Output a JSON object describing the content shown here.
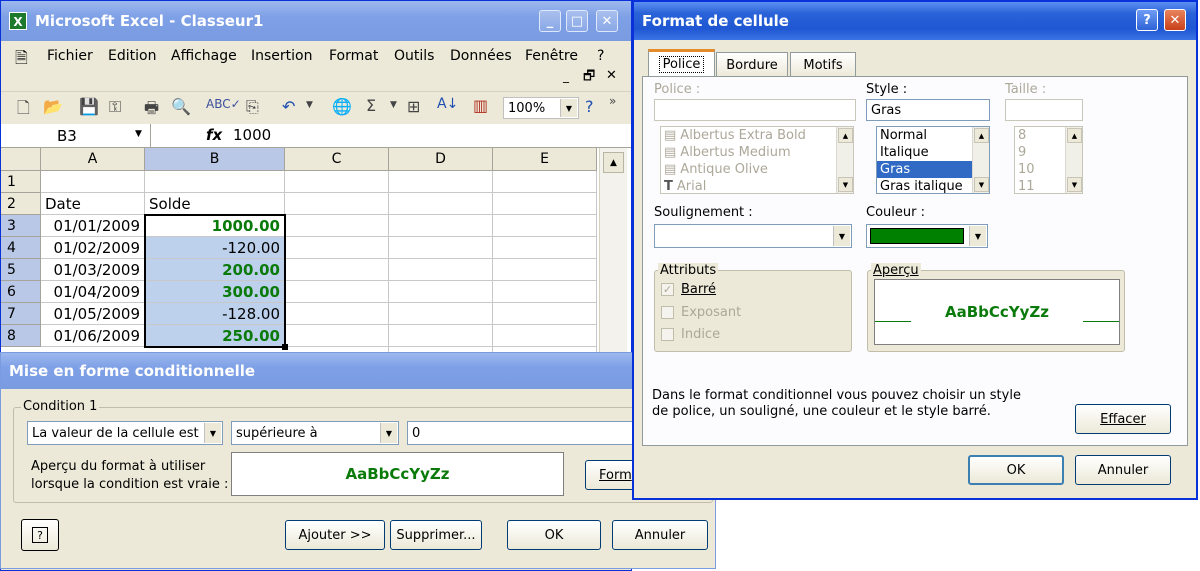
{
  "excel": {
    "title": "Microsoft Excel - Classeur1",
    "menu": [
      "Fichier",
      "Edition",
      "Affichage",
      "Insertion",
      "Format",
      "Outils",
      "Données",
      "Fenêtre",
      "?"
    ],
    "zoom": "100%",
    "name_box": "B3",
    "fx": "fx",
    "formula": "1000",
    "columns": [
      "A",
      "B",
      "C",
      "D",
      "E"
    ],
    "rows": [
      "1",
      "2",
      "3",
      "4",
      "5",
      "6",
      "7",
      "8"
    ],
    "cells": {
      "a2": "Date",
      "b2": "Solde",
      "a3": "01/01/2009",
      "b3": "1000.00",
      "a4": "01/02/2009",
      "b4": "-120.00",
      "a5": "01/03/2009",
      "b5": "200.00",
      "a6": "01/04/2009",
      "b6": "300.00",
      "a7": "01/05/2009",
      "b7": "-128.00",
      "a8": "01/06/2009",
      "b8": "250.00"
    },
    "accent_green": "#0a7a0a"
  },
  "cond": {
    "title": "Mise en forme conditionnelle",
    "group": "Condition 1",
    "op1": "La valeur de la cellule est",
    "op2": "supérieure à",
    "value": "0",
    "preview_label_1": "Aperçu du format à utiliser",
    "preview_label_2": "lorsque la condition est vraie :",
    "preview_text": "AaBbCcYyZz",
    "format_btn": "Form",
    "help": "?",
    "add": "Ajouter >>",
    "delete": "Supprimer...",
    "ok": "OK",
    "cancel": "Annuler"
  },
  "fmt": {
    "title": "Format de cellule",
    "tabs": [
      "Police",
      "Bordure",
      "Motifs"
    ],
    "police_label": "Police :",
    "style_label": "Style :",
    "taille_label": "Taille :",
    "style_value": "Gras",
    "fonts": [
      "Albertus Extra Bold",
      "Albertus Medium",
      "Antique Olive",
      "Arial"
    ],
    "styles": [
      "Normal",
      "Italique",
      "Gras",
      "Gras italique"
    ],
    "sizes": [
      "8",
      "9",
      "10",
      "11"
    ],
    "soulignement_label": "Soulignement :",
    "couleur_label": "Couleur :",
    "color_value": "#008000",
    "attributs": "Attributs",
    "barre": "Barré",
    "exposant": "Exposant",
    "indice": "Indice",
    "apercu": "Aperçu",
    "preview_text": "AaBbCcYyZz",
    "info_1": "Dans le format conditionnel vous pouvez choisir un style",
    "info_2": "de police, un souligné, une couleur et le style barré.",
    "effacer": "Effacer",
    "ok": "OK",
    "cancel": "Annuler"
  }
}
